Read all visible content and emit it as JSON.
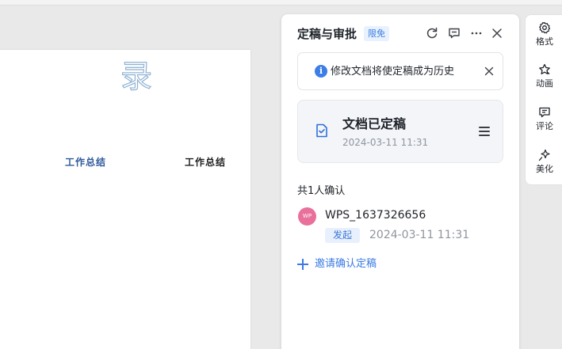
{
  "document": {
    "heading_char": "录",
    "cells": [
      "工作总结",
      "工作总结"
    ]
  },
  "panel": {
    "title": "定稿与审批",
    "badge": "限免",
    "header_icons": [
      "refresh-icon",
      "comment-icon",
      "more-icon",
      "close-icon"
    ],
    "notice": {
      "icon": "info-icon",
      "text": "修改文档将使定稿成为历史"
    },
    "status": {
      "title": "文档已定稿",
      "time": "2024-03-11 11:31"
    },
    "confirm_count": "共1人确认",
    "user": {
      "avatar": "WP",
      "name": "WPS_1637326656",
      "role": "发起",
      "time": "2024-03-11 11:31"
    },
    "invite_label": "邀请确认定稿"
  },
  "toolbar": {
    "items": [
      {
        "label": "格式",
        "icon": "gear-icon"
      },
      {
        "label": "动画",
        "icon": "star-icon"
      },
      {
        "label": "评论",
        "icon": "comment-icon"
      },
      {
        "label": "美化",
        "icon": "sparkle-icon"
      }
    ]
  },
  "colors": {
    "accent": "#3b7be3",
    "avatar": "#e8709a",
    "card_bg": "#f3f5f9"
  }
}
